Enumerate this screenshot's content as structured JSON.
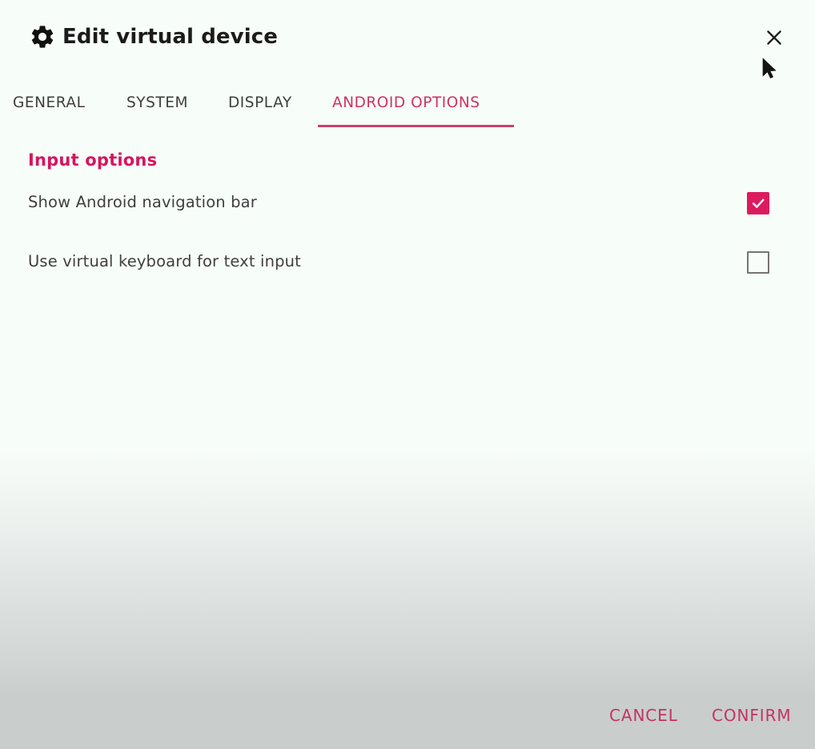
{
  "window": {
    "title": "Edit virtual device",
    "title_icon": "gear-icon",
    "close_icon": "close-icon"
  },
  "tabs": [
    {
      "label": "GENERAL",
      "active": false
    },
    {
      "label": "SYSTEM",
      "active": false
    },
    {
      "label": "DISPLAY",
      "active": false
    },
    {
      "label": "ANDROID OPTIONS",
      "active": true
    }
  ],
  "section": {
    "heading": "Input options",
    "options": [
      {
        "label": "Show Android navigation bar",
        "checked": true
      },
      {
        "label": "Use virtual keyboard for text input",
        "checked": false
      }
    ]
  },
  "footer": {
    "cancel_label": "CANCEL",
    "confirm_label": "CONFIRM"
  },
  "colors": {
    "accent": "#d6155e",
    "accent_muted": "#c33364",
    "tab_active": "#cf3366",
    "tab_inactive": "#3e3e3e",
    "checkbox_checked": "#dc1b5e",
    "checkbox_unchecked_border": "#757575",
    "label_text": "#3f3f3f",
    "title_text": "#1b1b1b",
    "background_top": "#f7fdf9",
    "background_bottom": "#c9cdcc"
  }
}
